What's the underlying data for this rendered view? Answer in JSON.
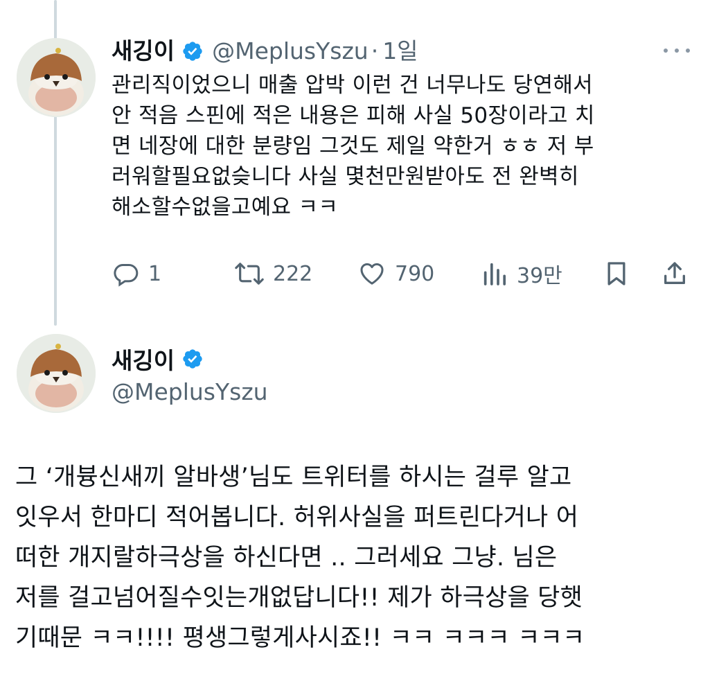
{
  "tweet1": {
    "display_name": "새깅이",
    "handle": "@MeplusYszu",
    "separator": "·",
    "time": "1일",
    "body_lines": [
      "관리직이었으니 매출 압박 이런 건 너무나도 당연해서",
      "안 적음 스핀에 적은 내용은 피해 사실 50장이라고 치",
      "면 네장에 대한 분량임  그것도 제일 약한거 ㅎㅎ 저 부",
      "러워할필요없슺니다 사실 몇천만원받아도 전 완벽히",
      "해소할수없을고예요 ㅋㅋ"
    ],
    "actions": {
      "reply_count": "1",
      "retweet_count": "222",
      "like_count": "790",
      "views_count": "39만"
    }
  },
  "tweet2": {
    "display_name": "새깅이",
    "handle": "@MeplusYszu",
    "body_lines": [
      "그 ‘개븅신새끼 알바생’님도 트위터를 하시는 걸루 알고",
      "잇우서 한마디 적어봅니다. 허위사실을 퍼트린다거나 어",
      "떠한 개지랄하극상을 하신다면 .. 그러세요 그냥. 님은",
      "저를 걸고넘어질수잇는개없답니다!! 제가 하극상을 당햇",
      "기때문 ㅋㅋ!!!! 평생그렇게사시죠!! ㅋㅋ ㅋㅋㅋ ㅋㅋㅋ"
    ]
  },
  "colors": {
    "verified_blue": "#1d9bf0",
    "secondary_text": "#536471",
    "thread_line": "#cfd9de"
  },
  "icons": {
    "verified": "verified-badge-icon",
    "more": "more-dots-icon",
    "reply": "reply-icon",
    "retweet": "retweet-icon",
    "like": "heart-icon",
    "views": "views-chart-icon",
    "bookmark": "bookmark-icon",
    "share": "share-icon"
  }
}
